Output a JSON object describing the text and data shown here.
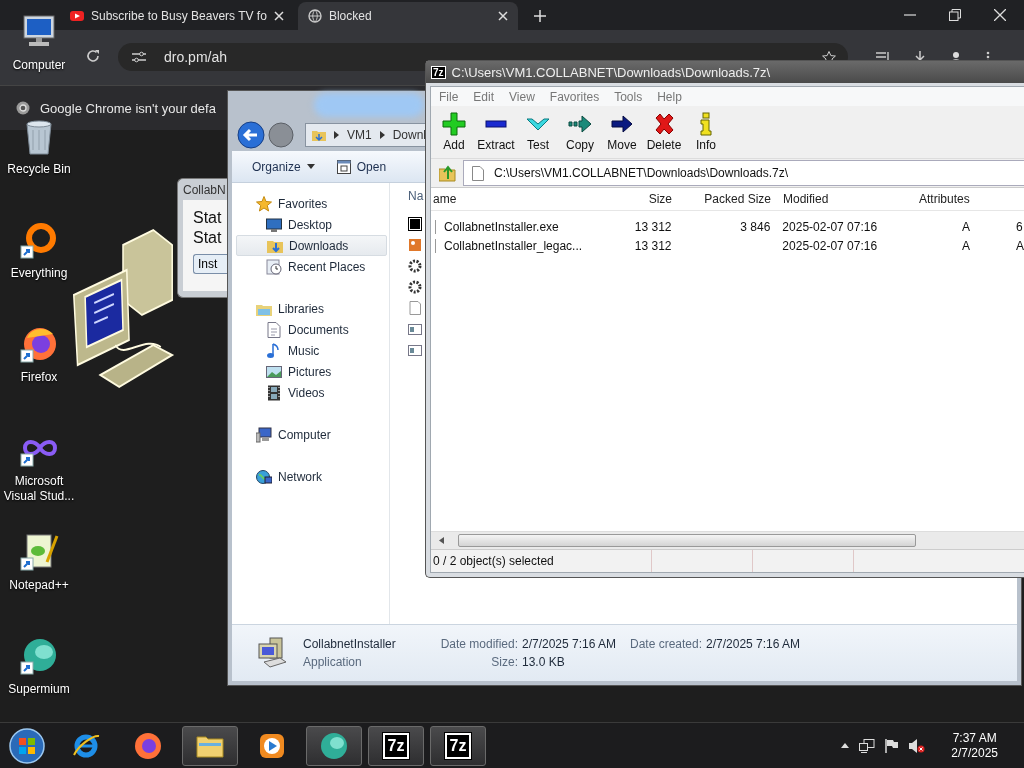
{
  "browser": {
    "tabs": [
      {
        "title": "Subscribe to Busy Beavers TV fo",
        "kind": "video",
        "selected": false
      },
      {
        "title": "Blocked",
        "kind": "globe",
        "selected": true
      }
    ],
    "address": "dro.pm/ah",
    "infobar_text": "Google Chrome isn't your defa"
  },
  "desktop_icons": [
    {
      "label": "Computer",
      "kind": "computer"
    },
    {
      "label": "Recycle Bin",
      "kind": "recycle"
    },
    {
      "label": "Everything",
      "kind": "everything"
    },
    {
      "label": "Firefox",
      "kind": "firefox"
    },
    {
      "label": "Microsoft Visual Stud...",
      "kind": "visualstudio"
    },
    {
      "label": "Notepad++",
      "kind": "notepad"
    },
    {
      "label": "Supermium",
      "kind": "supermium"
    }
  ],
  "installer_dialog": {
    "title": "CollabN",
    "lines": [
      "Stat",
      "Stat"
    ],
    "button": "Inst"
  },
  "explorer": {
    "breadcrumbs": [
      "VM1",
      "Downl"
    ],
    "toolbar": [
      {
        "label": "Organize",
        "kind": "menu"
      },
      {
        "label": "Open",
        "kind": "open"
      }
    ],
    "nav": [
      {
        "label": "Favorites",
        "kind": "star",
        "selected": false,
        "children": [
          {
            "label": "Desktop",
            "kind": "desktop",
            "selected": false
          },
          {
            "label": "Downloads",
            "kind": "downloads",
            "selected": true
          },
          {
            "label": "Recent Places",
            "kind": "recent",
            "selected": false
          }
        ]
      },
      {
        "label": "Libraries",
        "kind": "libraries",
        "selected": false,
        "children": [
          {
            "label": "Documents",
            "kind": "documents",
            "selected": false
          },
          {
            "label": "Music",
            "kind": "music",
            "selected": false
          },
          {
            "label": "Pictures",
            "kind": "pictures",
            "selected": false
          },
          {
            "label": "Videos",
            "kind": "videos",
            "selected": false
          }
        ]
      },
      {
        "label": "Computer",
        "kind": "computer",
        "selected": false
      },
      {
        "label": "Network",
        "kind": "network",
        "selected": false
      }
    ],
    "list_column": "Na",
    "details": {
      "name": "CollabnetInstaller",
      "type": "Application",
      "fields": [
        {
          "label": "Date modified:",
          "value": "2/7/2025 7:16 AM"
        },
        {
          "label": "Size:",
          "value": "13.0 KB"
        },
        {
          "label": "Date created:",
          "value": "2/7/2025 7:16 AM"
        }
      ]
    }
  },
  "sevenzip": {
    "logo": "7z",
    "title": "C:\\Users\\VM1.COLLABNET\\Downloads\\Downloads.7z\\",
    "menu": [
      "File",
      "Edit",
      "View",
      "Favorites",
      "Tools",
      "Help"
    ],
    "toolbar": [
      {
        "label": "Add",
        "kind": "add"
      },
      {
        "label": "Extract",
        "kind": "extract"
      },
      {
        "label": "Test",
        "kind": "test"
      },
      {
        "label": "Copy",
        "kind": "copy"
      },
      {
        "label": "Move",
        "kind": "move"
      },
      {
        "label": "Delete",
        "kind": "delete"
      },
      {
        "label": "Info",
        "kind": "info"
      }
    ],
    "path": "C:\\Users\\VM1.COLLABNET\\Downloads\\Downloads.7z\\",
    "columns": [
      "ame",
      "Size",
      "Packed Size",
      "Modified",
      "Attributes"
    ],
    "rows": [
      {
        "name": "CollabnetInstaller.exe",
        "size": "13 312",
        "packed_size": "3 846",
        "modified": "2025-02-07 07:16",
        "attributes": "A",
        "column_6": "6"
      },
      {
        "name": "CollabnetInstaller_legac...",
        "size": "13 312",
        "modified": "2025-02-07 07:16",
        "attributes": "A",
        "column_6": "A"
      }
    ],
    "status": "0 / 2 object(s) selected"
  },
  "taskbar": {
    "buttons": [
      {
        "kind": "ie",
        "running": false
      },
      {
        "kind": "firefox",
        "running": false
      },
      {
        "kind": "explorer",
        "running": true
      },
      {
        "kind": "media",
        "running": false
      },
      {
        "kind": "supermium",
        "running": true
      },
      {
        "kind": "sevenzip",
        "logo": "7z",
        "running": true
      },
      {
        "kind": "sevenzip",
        "logo": "7z",
        "running": true
      }
    ],
    "time": "7:37 AM",
    "date": "2/7/2025"
  }
}
